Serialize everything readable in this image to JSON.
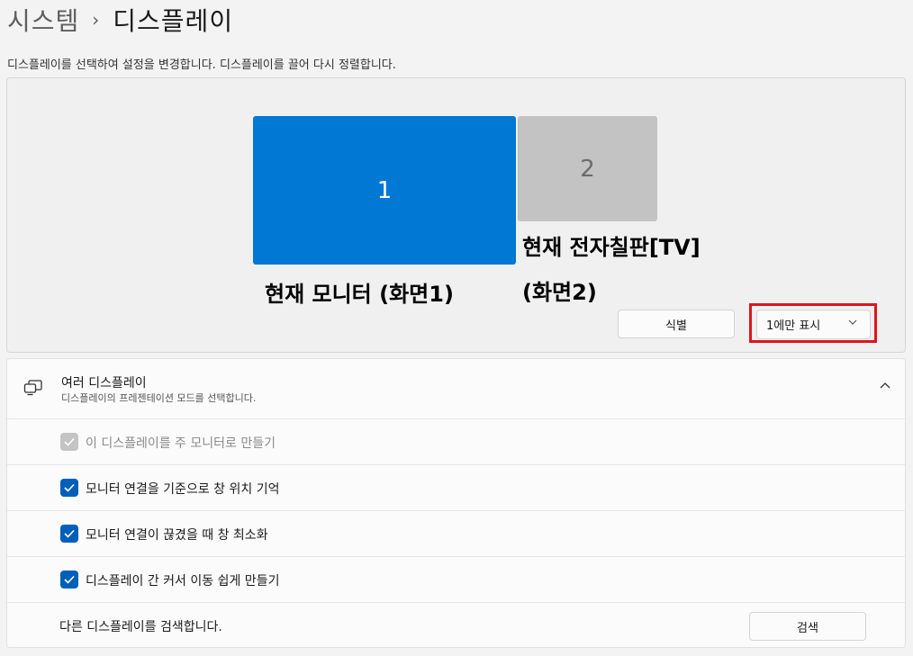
{
  "breadcrumb": {
    "parent": "시스템",
    "separator": "›",
    "current": "디스플레이"
  },
  "description": "디스플레이를 선택하여 설정을 변경합니다. 디스플레이를 끌어 다시 정렬합니다.",
  "monitors": [
    {
      "number": "1",
      "annotation": "현재 모니터 (화면1)",
      "selected": true,
      "color": "#0078d4"
    },
    {
      "number": "2",
      "annotation_line1": "현재 전자칠판[TV]",
      "annotation_line2": "(화면2)",
      "selected": false,
      "color": "#c3c3c3"
    }
  ],
  "identify_button": "식별",
  "projection_dropdown": {
    "selected": "1에만 표시"
  },
  "highlight_color": "#e0141c",
  "multi_display": {
    "title": "여러 디스플레이",
    "subtitle": "디스플레이의 프레젠테이션 모드를 선택합니다.",
    "expanded": true,
    "options": [
      {
        "label": "이 디스플레이를 주 모니터로 만들기",
        "checked": true,
        "disabled": true
      },
      {
        "label": "모니터 연결을 기준으로 창 위치 기억",
        "checked": true,
        "disabled": false
      },
      {
        "label": "모니터 연결이 끊겼을 때 창 최소화",
        "checked": true,
        "disabled": false
      },
      {
        "label": "디스플레이 간 커서 이동 쉽게 만들기",
        "checked": true,
        "disabled": false
      }
    ],
    "detect_label": "다른 디스플레이를 검색합니다.",
    "detect_button": "검색"
  },
  "accent_color": "#005fb8"
}
